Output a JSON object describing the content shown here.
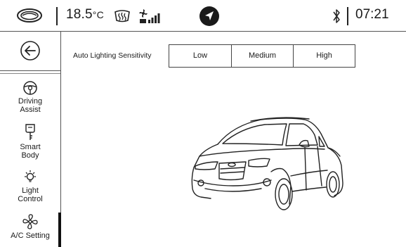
{
  "status_bar": {
    "temperature_value": "18.5",
    "temperature_unit": "°C",
    "time": "07:21",
    "icons": [
      "brand-logo-icon",
      "rear-defrost-icon",
      "fan-speed-icon",
      "navigation-icon",
      "bluetooth-icon"
    ]
  },
  "sidebar": {
    "back_icon": "back-arrow-icon",
    "items": [
      {
        "label_line1": "Driving",
        "label_line2": "Assist",
        "icon": "steering-wheel-icon"
      },
      {
        "label_line1": "Smart",
        "label_line2": "Body",
        "icon": "key-icon"
      },
      {
        "label_line1": "Light",
        "label_line2": "Control",
        "icon": "light-bulb-icon"
      },
      {
        "label_line1": "A/C Setting",
        "label_line2": "",
        "icon": "fan-icon",
        "active": true
      }
    ]
  },
  "main": {
    "setting_label": "Auto Lighting Sensitivity",
    "options": [
      "Low",
      "Medium",
      "High"
    ],
    "illustration": "car-icon"
  }
}
